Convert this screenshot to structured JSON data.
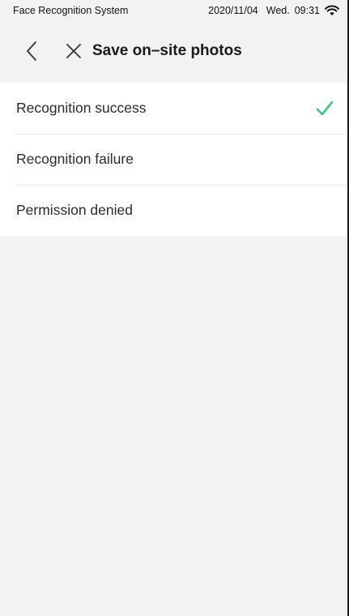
{
  "status_bar": {
    "app_name": "Face Recognition System",
    "date": "2020/11/04",
    "weekday": "Wed.",
    "time": "09:31",
    "wifi_icon": "wifi-icon"
  },
  "header": {
    "back_icon": "chevron-left-icon",
    "close_icon": "close-icon",
    "title": "Save on–site photos"
  },
  "options": [
    {
      "label": "Recognition success",
      "selected": true
    },
    {
      "label": "Recognition failure",
      "selected": false
    },
    {
      "label": "Permission denied",
      "selected": false
    }
  ],
  "colors": {
    "check": "#3cc27a",
    "background": "#f2f2f2",
    "list_bg": "#ffffff"
  }
}
